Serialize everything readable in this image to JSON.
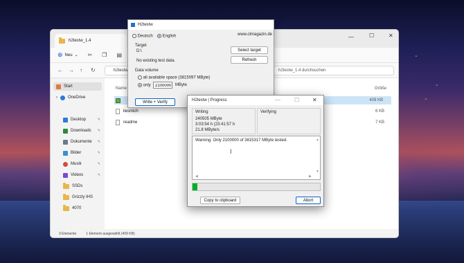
{
  "explorer": {
    "tab_title": "h2testw_1.4",
    "toolbar": {
      "new_label": "Neu"
    },
    "search_placeholder": "h2testw_1.4 durchsuchen",
    "columns": {
      "name": "Name",
      "size": "Größe"
    },
    "sidebar": [
      {
        "label": "Start",
        "color": "#e07a3a"
      },
      {
        "label": "OneDrive",
        "color": "#2b7bd6"
      },
      {
        "label": "Desktop",
        "color": "#2b7bd6"
      },
      {
        "label": "Downloads",
        "color": "#2b8a3e"
      },
      {
        "label": "Dokumente",
        "color": "#6b7a8c"
      },
      {
        "label": "Bilder",
        "color": "#3b8ed0"
      },
      {
        "label": "Musik",
        "color": "#d04a3b"
      },
      {
        "label": "Videos",
        "color": "#7a4ad0"
      },
      {
        "label": "SSDs",
        "color": "#e8b64a"
      },
      {
        "label": "Grizzly IHS",
        "color": "#e8b64a"
      },
      {
        "label": "4070",
        "color": "#e8b64a"
      }
    ],
    "files": [
      {
        "name": "",
        "size": "409 KB",
        "selected": true
      },
      {
        "name": "liesmich",
        "size": "6 KB"
      },
      {
        "name": "readme",
        "size": "7 KB"
      }
    ],
    "status": {
      "count": "3 Elemente",
      "selection": "1 Element ausgewählt (409 KB)"
    }
  },
  "h2testw": {
    "title": "H2testw",
    "lang_de": "Deutsch",
    "lang_en": "English",
    "website": "www.ctmagazin.de",
    "target_label": "Target",
    "target_path": "D:\\",
    "select_target": "Select target",
    "no_test_data": "No existing test data.",
    "refresh": "Refresh",
    "data_volume_label": "Data volume",
    "all_space": "all available space (3815097 MByte)",
    "only_label": "only",
    "only_value": "2100000",
    "unit": "MByte",
    "write_verify": "Write + Verify"
  },
  "progress": {
    "title": "H2testw | Progress",
    "writing_label": "Writing",
    "verifying_label": "Verifying",
    "written": "240505 MByte",
    "elapsed": "3:03:54 h (23:41:57 h",
    "rate": "21.8 MByte/s",
    "warning": "Warning: Only 2100000 of 3815317 MByte tested.",
    "progress_value": 0.04,
    "copy_button": "Copy to clipboard",
    "abort_button": "Abort"
  }
}
